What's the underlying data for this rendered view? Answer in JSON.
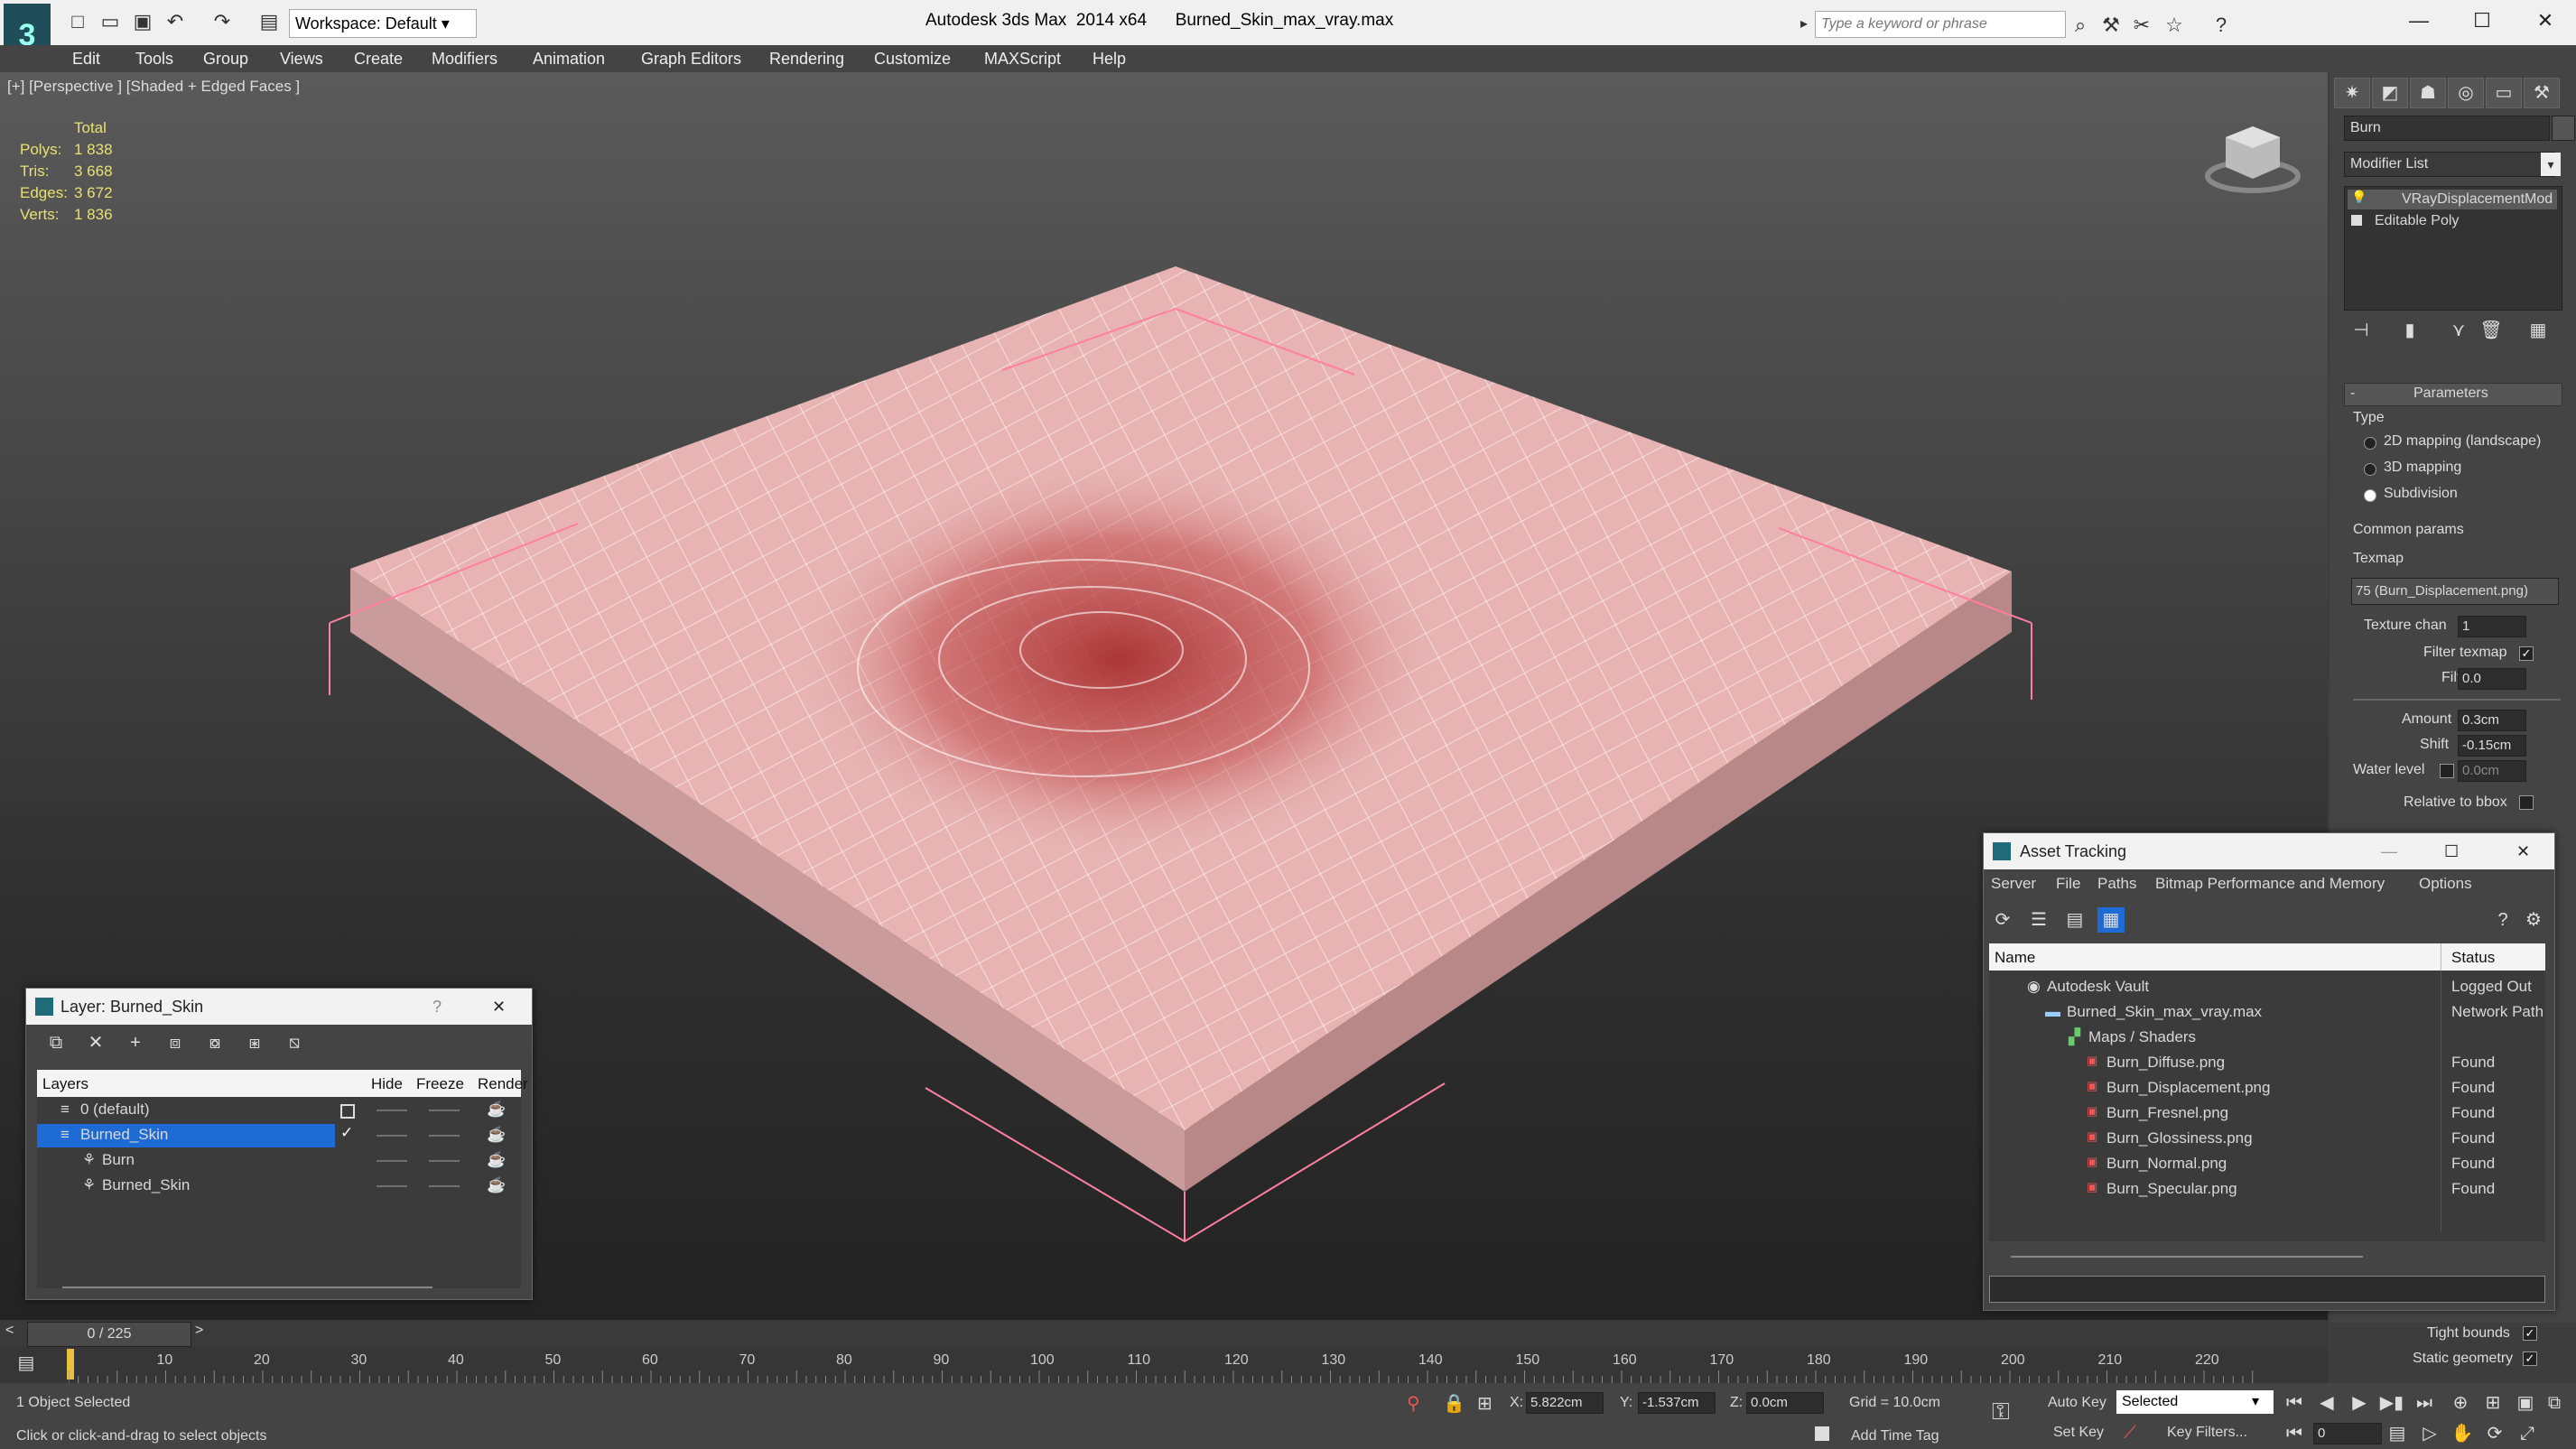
{
  "titlebar": {
    "app_title": "Autodesk 3ds Max  2014 x64",
    "file_name": "Burned_Skin_max_vray.max",
    "workspace": "Workspace: Default",
    "search_placeholder": "Type a keyword or phrase",
    "logo": "3"
  },
  "menu": [
    "Edit",
    "Tools",
    "Group",
    "Views",
    "Create",
    "Modifiers",
    "Animation",
    "Graph Editors",
    "Rendering",
    "Customize",
    "MAXScript",
    "Help"
  ],
  "viewport": {
    "label": "[+] [Perspective ] [Shaded + Edged Faces ]",
    "stats_header": "Total",
    "stats": [
      {
        "label": "Polys:",
        "value": "1 838"
      },
      {
        "label": "Tris:",
        "value": "3 668"
      },
      {
        "label": "Edges:",
        "value": "3 672"
      },
      {
        "label": "Verts:",
        "value": "1 836"
      }
    ]
  },
  "command_panel": {
    "object_name": "Burn",
    "modifier_list": "Modifier List",
    "stack": [
      "VRayDisplacementMod",
      "Editable Poly"
    ],
    "rollout_title": "Parameters",
    "type_label": "Type",
    "type_options": [
      {
        "label": "2D mapping (landscape)",
        "selected": false
      },
      {
        "label": "3D mapping",
        "selected": false
      },
      {
        "label": "Subdivision",
        "selected": true
      }
    ],
    "common_params": "Common params",
    "texmap_label": "Texmap",
    "texmap_value": "75 (Burn_Displacement.png)",
    "texture_chan_label": "Texture chan",
    "texture_chan_value": "1",
    "filter_texmap_label": "Filter texmap",
    "filter_blur_label": "Filter blur",
    "filter_blur_value": "0.0",
    "amount_label": "Amount",
    "amount_value": "0.3cm",
    "shift_label": "Shift",
    "shift_value": "-0.15cm",
    "water_level_label": "Water level",
    "water_level_value": "0.0cm",
    "relative_bbox_label": "Relative to bbox",
    "tight_bounds_label": "Tight bounds",
    "static_geometry_label": "Static geometry"
  },
  "asset_tracking": {
    "title": "Asset Tracking",
    "menu": [
      "Server",
      "File",
      "Paths",
      "Bitmap Performance and Memory",
      "Options"
    ],
    "col_name": "Name",
    "col_status": "Status",
    "rows": [
      {
        "name": "Autodesk Vault",
        "status": "Logged Out",
        "indent": 1
      },
      {
        "name": "Burned_Skin_max_vray.max",
        "status": "Network Path",
        "indent": 2
      },
      {
        "name": "Maps / Shaders",
        "status": "",
        "indent": 3
      },
      {
        "name": "Burn_Diffuse.png",
        "status": "Found",
        "indent": 4
      },
      {
        "name": "Burn_Displacement.png",
        "status": "Found",
        "indent": 4
      },
      {
        "name": "Burn_Fresnel.png",
        "status": "Found",
        "indent": 4
      },
      {
        "name": "Burn_Glossiness.png",
        "status": "Found",
        "indent": 4
      },
      {
        "name": "Burn_Normal.png",
        "status": "Found",
        "indent": 4
      },
      {
        "name": "Burn_Specular.png",
        "status": "Found",
        "indent": 4
      }
    ]
  },
  "layer_window": {
    "title": "Layer: Burned_Skin",
    "help": "?",
    "col_layers": "Layers",
    "col_hide": "Hide",
    "col_freeze": "Freeze",
    "col_render": "Render",
    "rows": [
      {
        "name": "0 (default)",
        "indent": 1,
        "selected": false
      },
      {
        "name": "Burned_Skin",
        "indent": 1,
        "selected": true
      },
      {
        "name": "Burn",
        "indent": 2,
        "selected": false
      },
      {
        "name": "Burned_Skin",
        "indent": 2,
        "selected": false
      }
    ]
  },
  "timeline": {
    "frame_counter": "0 / 225",
    "ticks": [
      "10",
      "20",
      "30",
      "40",
      "50",
      "60",
      "70",
      "80",
      "90",
      "100",
      "110",
      "120",
      "130",
      "140",
      "150",
      "160",
      "170",
      "180",
      "190",
      "200",
      "210",
      "220"
    ]
  },
  "status": {
    "selection": "1 Object Selected",
    "prompt": "Click or click-and-drag to select objects",
    "x_label": "X:",
    "x_value": "5.822cm",
    "y_label": "Y:",
    "y_value": "-1.537cm",
    "z_label": "Z:",
    "z_value": "0.0cm",
    "grid": "Grid = 10.0cm",
    "add_time_tag": "Add Time Tag",
    "auto_key": "Auto Key",
    "set_key": "Set Key",
    "selected_dropdown": "Selected",
    "key_filters": "Key Filters...",
    "frame_value": "0"
  },
  "colors": {
    "accent": "#1e6bd6",
    "mesh": "#e8b4b4",
    "burn": "#a83030",
    "highlight": "#ff7fa0"
  }
}
